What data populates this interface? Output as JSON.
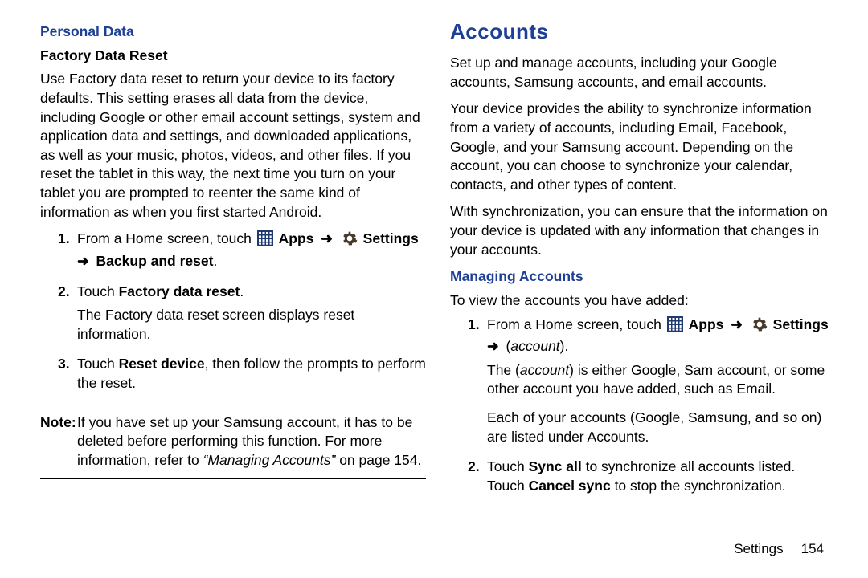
{
  "left": {
    "blue_heading": "Personal Data",
    "sub_heading": "Factory Data Reset",
    "intro": "Use Factory data reset to return your device to its factory defaults. This setting erases all data from the device, including Google or other email account settings, system and application data and settings, and downloaded applications, as well as your music, photos, videos, and other files. If you reset the tablet in this way, the next time you turn on your tablet you are prompted to reenter the same kind of information as when you first started Android.",
    "steps": {
      "s1_num": "1.",
      "s1_pre": "From a Home screen, touch ",
      "s1_apps": " Apps ",
      "s1_settings": " Settings ",
      "s1_tail": " Backup and reset",
      "s2_num": "2.",
      "s2_pre": "Touch ",
      "s2_bold": "Factory data reset",
      "s2_line2": "The Factory data reset screen displays reset information.",
      "s3_num": "3.",
      "s3_pre": "Touch ",
      "s3_bold": "Reset device",
      "s3_post": ", then follow the prompts to perform the reset."
    },
    "note_label": "Note:",
    "note_body_pre": "If you have set up your Samsung account, it has to be deleted before performing this function. For more information, refer to ",
    "note_ref": "“Managing Accounts”",
    "note_body_post": " on page 154."
  },
  "right": {
    "heading": "Accounts",
    "p1": "Set up and manage accounts, including your Google accounts, Samsung accounts, and email accounts.",
    "p2": "Your device provides the ability to synchronize information from a variety of accounts, including Email, Facebook, Google, and your Samsung account. Depending on the account, you can choose to synchronize your calendar, contacts, and other types of content.",
    "p3": "With synchronization, you can ensure that the information on your device is updated with any information that changes in your accounts.",
    "blue_heading": "Managing Accounts",
    "intro": "To view the accounts you have added:",
    "steps": {
      "s1_num": "1.",
      "s1_pre": "From a Home screen, touch ",
      "s1_apps": " Apps ",
      "s1_settings": " Settings ",
      "s1_tail_open": " (",
      "s1_account": "account",
      "s1_tail_close": ").",
      "s1_line2a": "The (",
      "s1_line2_acc": "account",
      "s1_line2b": ") is either Google, Sam account, or some other account you have added, such as Email.",
      "s1_line3": "Each of your accounts (Google, Samsung, and so on) are listed under Accounts.",
      "s2_num": "2.",
      "s2_pre": "Touch ",
      "s2_bold1": "Sync all",
      "s2_mid": " to synchronize all accounts listed. Touch ",
      "s2_bold2": "Cancel sync",
      "s2_post": " to stop the synchronization."
    }
  },
  "footer": {
    "label": "Settings",
    "page": "154"
  },
  "icons": {
    "apps": "apps-grid-icon",
    "settings": "settings-gear-icon",
    "arrow": "➜"
  }
}
